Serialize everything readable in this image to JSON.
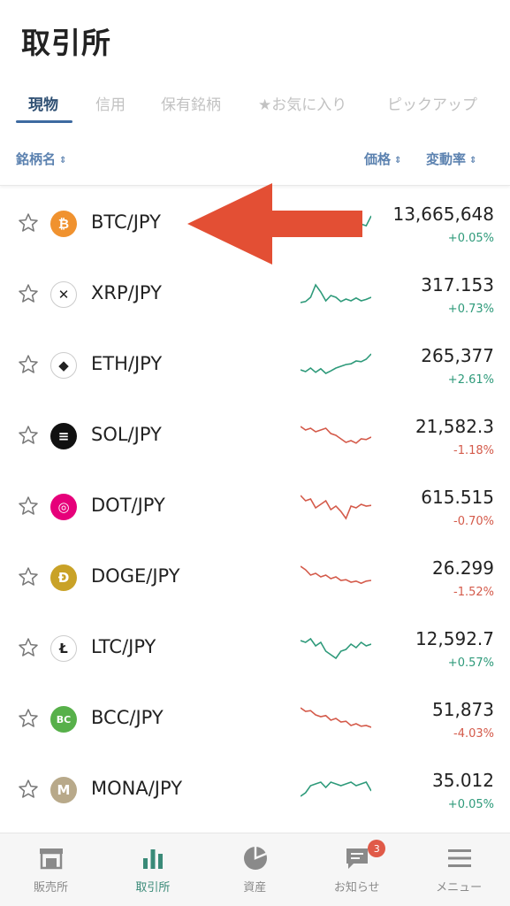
{
  "header": {
    "title": "取引所"
  },
  "tabs": [
    {
      "label": "現物",
      "active": true
    },
    {
      "label": "信用",
      "active": false
    },
    {
      "label": "保有銘柄",
      "active": false
    },
    {
      "label": "★お気に入り",
      "active": false
    },
    {
      "label": "ピックアップ",
      "active": false
    }
  ],
  "columns": {
    "name": "銘柄名",
    "price": "価格",
    "change": "変動率",
    "sort_glyph": "⇕"
  },
  "colors": {
    "up": "#2e9a7a",
    "down": "#d45a4a",
    "accent": "#3d6aa0",
    "arrow": "#e34f34"
  },
  "rows": [
    {
      "pair": "BTC/JPY",
      "price": "13,665,648",
      "change": "+0.05%",
      "direction": "up",
      "icon": "bitcoin-icon",
      "coin_color": "#f0922f",
      "glyph": "₿"
    },
    {
      "pair": "XRP/JPY",
      "price": "317.153",
      "change": "+0.73%",
      "direction": "up",
      "icon": "xrp-icon",
      "coin_color": "#ffffff",
      "glyph": "✕"
    },
    {
      "pair": "ETH/JPY",
      "price": "265,377",
      "change": "+2.61%",
      "direction": "up",
      "icon": "ethereum-icon",
      "coin_color": "#ffffff",
      "glyph": "◆"
    },
    {
      "pair": "SOL/JPY",
      "price": "21,582.3",
      "change": "-1.18%",
      "direction": "down",
      "icon": "solana-icon",
      "coin_color": "#111111",
      "glyph": "≡"
    },
    {
      "pair": "DOT/JPY",
      "price": "615.515",
      "change": "-0.70%",
      "direction": "down",
      "icon": "polkadot-icon",
      "coin_color": "#e6007a",
      "glyph": "◎"
    },
    {
      "pair": "DOGE/JPY",
      "price": "26.299",
      "change": "-1.52%",
      "direction": "down",
      "icon": "dogecoin-icon",
      "coin_color": "#c9a227",
      "glyph": "Ð"
    },
    {
      "pair": "LTC/JPY",
      "price": "12,592.7",
      "change": "+0.57%",
      "direction": "up",
      "icon": "litecoin-icon",
      "coin_color": "#ffffff",
      "glyph": "Ł"
    },
    {
      "pair": "BCC/JPY",
      "price": "51,873",
      "change": "-4.03%",
      "direction": "down",
      "icon": "bitcoin-cash-icon",
      "coin_color": "#57b04a",
      "glyph": "BC"
    },
    {
      "pair": "MONA/JPY",
      "price": "35.012",
      "change": "+0.05%",
      "direction": "up",
      "icon": "monacoin-icon",
      "coin_color": "#b8a98a",
      "glyph": "M"
    }
  ],
  "bottom_nav": [
    {
      "label": "販売所",
      "icon": "store-icon",
      "active": false
    },
    {
      "label": "取引所",
      "icon": "bar-chart-icon",
      "active": true
    },
    {
      "label": "資産",
      "icon": "pie-chart-icon",
      "active": false
    },
    {
      "label": "お知らせ",
      "icon": "message-icon",
      "active": false,
      "badge": "3"
    },
    {
      "label": "メニュー",
      "icon": "hamburger-menu-icon",
      "active": false
    }
  ]
}
